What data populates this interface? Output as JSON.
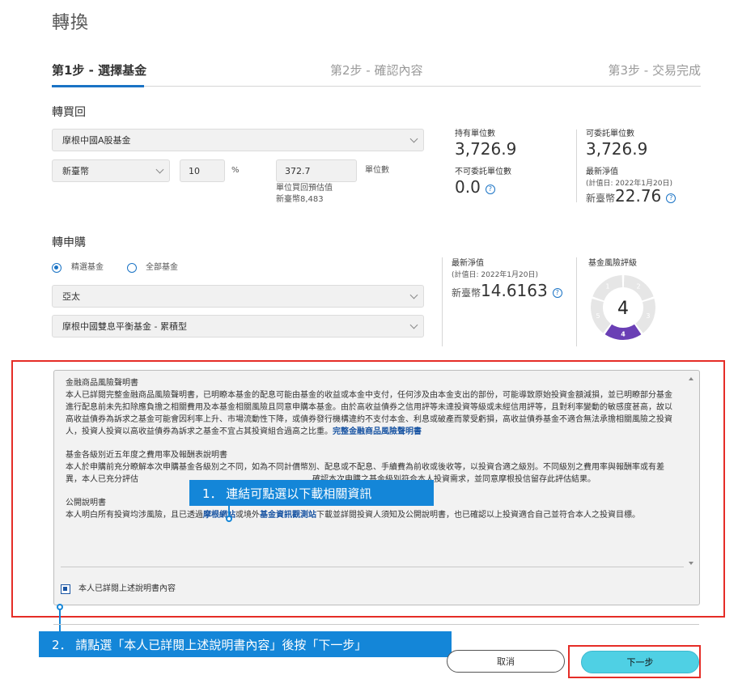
{
  "page": {
    "title": "轉換"
  },
  "steps": [
    {
      "label": "第1步 - 選擇基金"
    },
    {
      "label": "第2步 - 確認內容"
    },
    {
      "label": "第3步 - 交易完成"
    }
  ],
  "redeem": {
    "section_label": "轉買回",
    "fund": "摩根中國A股基金",
    "currency": "新臺幣",
    "percent_value": "10",
    "percent_unit": "%",
    "units_value": "372.7",
    "units_unit": "單位數",
    "estimate_label": "單位買回預估值",
    "estimate_value": "新臺幣8,483",
    "held_units_label": "持有單位數",
    "held_units_value": "3,726.9",
    "nontrust_label": "不可委託單位數",
    "nontrust_value": "0.0",
    "trust_label": "可委託單位數",
    "trust_value": "3,726.9",
    "nav_label": "最新淨值",
    "nav_date": "(計值日: 2022年1月20日)",
    "nav_currency": "新臺幣",
    "nav_value": "22.76"
  },
  "subscribe": {
    "section_label": "轉申購",
    "radio_selected": "精選基金",
    "radio_all": "全部基金",
    "region": "亞太",
    "fund": "摩根中國雙息平衡基金 - 累積型",
    "nav_label": "最新淨值",
    "nav_date": "(計值日: 2022年1月20日)",
    "nav_currency": "新臺幣",
    "nav_value": "14.6163",
    "risk_label": "基金風險評級",
    "risk_level": 4,
    "risk_levels": [
      "1",
      "2",
      "3",
      "4",
      "5"
    ],
    "risk_active_color": "#6a3fb5"
  },
  "disclosure": {
    "sec1_title": "金融商品風險聲明書",
    "sec1_body": "本人已詳閱完整金融商品風險聲明書，已明瞭本基金的配息可能由基金的收益或本金中支付，任何涉及由本金支出的部份，可能導致原始投資金額減損，並已明瞭部分基金進行配息前未先扣除應負擔之相關費用及本基金相關風險且同意申購本基金。由於高收益債券之信用評等未達投資等級或未經信用評等，且對利率變動的敏感度甚高，故以高收益債券為訴求之基金可能會因利率上升、市場流動性下降，或債券發行機構違約不支付本金、利息或破產而蒙受虧損，高收益債券基金不適合無法承擔相關風險之投資人，投資人投資以高收益債券為訴求之基金不宜占其投資組合過高之比重。",
    "sec1_link": "完整金融商品風險聲明書",
    "sec2_title": "基金各級別近五年度之費用率及報酬表說明書",
    "sec2_body_a": "本人於申購前充分瞭解本次申購基金各級別之不同，如為不同計價幣別、配息或不配息、手續費為前收或後收等，以投資合適之級別。不同級別之費用率與報酬率或有差異，本人已充分評估",
    "sec2_body_b": "確認本次申購之基金級別符合本人投資需求，並同意摩根投信留存此評估結果。",
    "sec3_title": "公開說明書",
    "sec3_body_a": "本人明白所有投資均涉風險，且已透過",
    "sec3_link1": "摩根網站",
    "sec3_body_b": "或境外",
    "sec3_link2": "基金資訊觀測站",
    "sec3_body_c": "下載並詳閱投資人須知及公開說明書，也已確認以上投資適合自己並符合本人之投資目標。",
    "agree_label": "本人已詳閱上述說明書內容"
  },
  "callouts": {
    "c1": "1．  連結可點選以下載相關資訊",
    "c2": "2．  請點選「本人已詳閱上述說明書內容」後按「下一步」"
  },
  "buttons": {
    "cancel": "取消",
    "next": "下一步"
  }
}
